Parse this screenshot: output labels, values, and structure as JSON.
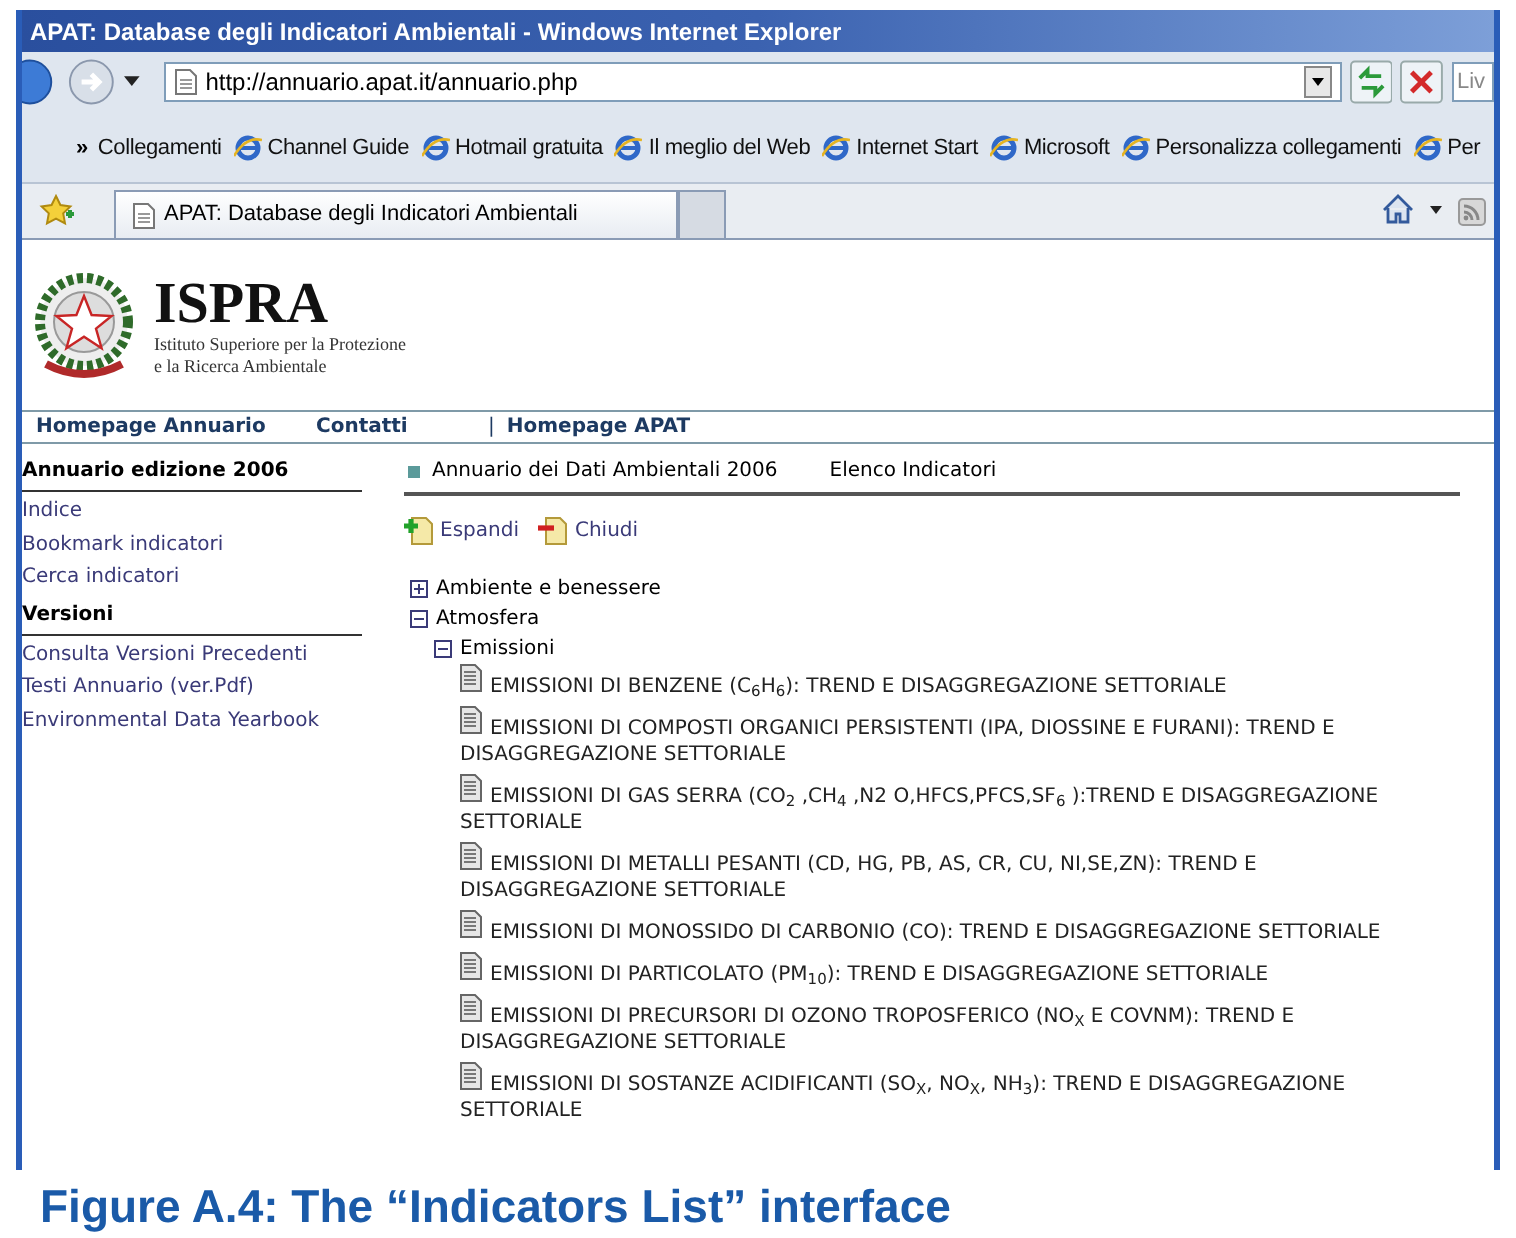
{
  "window": {
    "title": "APAT: Database degli Indicatori Ambientali - Windows Internet Explorer"
  },
  "address_bar": {
    "url": "http://annuario.apat.it/annuario.php",
    "search_placeholder": "Liv"
  },
  "links_bar": {
    "chevron": "»",
    "items": [
      "Collegamenti",
      "Channel Guide",
      "Hotmail gratuita",
      "Il meglio del Web",
      "Internet Start",
      "Microsoft",
      "Personalizza collegamenti",
      "Per"
    ]
  },
  "tabs": [
    {
      "label": "APAT: Database degli Indicatori Ambientali",
      "selected": true
    },
    {
      "selected": false
    }
  ],
  "header": {
    "logo_text": "ISPRA",
    "subtitle": [
      "Istituto Superiore per la Protezione",
      "e la Ricerca Ambientale"
    ]
  },
  "nav": [
    {
      "label": "Homepage Annuario"
    },
    {
      "label": "Contatti"
    },
    {
      "label": "Homepage APAT",
      "separator": "|"
    }
  ],
  "sidebar": [
    {
      "title": "Annuario edizione 2006",
      "items": [
        "Indice",
        "Bookmark indicatori",
        "Cerca indicatori"
      ]
    },
    {
      "title": "Versioni",
      "items": [
        "Consulta Versioni Precedenti",
        "Testi Annuario (ver.Pdf)",
        "Environmental Data Yearbook"
      ]
    }
  ],
  "breadcrumb": [
    "Annuario dei Dati Ambientali 2006",
    "Elenco Indicatori"
  ],
  "actions": [
    {
      "kind": "expand",
      "label": "Espandi"
    },
    {
      "kind": "collapse",
      "label": "Chiudi"
    }
  ],
  "tree": [
    {
      "kind": "folder",
      "label": "Ambiente e benessere",
      "expanded": false
    },
    {
      "kind": "folder",
      "label": "Atmosfera",
      "expanded": true,
      "children": [
        {
          "kind": "folder",
          "label": "Emissioni",
          "expanded": true,
          "children": [
            {
              "kind": "document",
              "label": "EMISSIONI DI BENZENE (C$_{6}$H$_{6}$): TREND E DISAGGREGAZIONE SETTORIALE"
            },
            {
              "kind": "document",
              "label": "EMISSIONI DI COMPOSTI ORGANICI PERSISTENTI (IPA, DIOSSINE E FURANI): TREND E DISAGGREGAZIONE SETTORIALE"
            },
            {
              "kind": "document",
              "label": "EMISSIONI DI GAS SERRA (CO$_{2}$ ,CH$_{4}$ ,N2 O,HFCS,PFCS,SF$_{6}$ ):TREND E DISAGGREGAZIONE SETTORIALE"
            },
            {
              "kind": "document",
              "label": "EMISSIONI DI METALLI PESANTI (CD, HG, PB, AS, CR, CU, NI,SE,ZN): TREND E DISAGGREGAZIONE SETTORIALE"
            },
            {
              "kind": "document",
              "label": "EMISSIONI DI MONOSSIDO DI CARBONIO (CO): TREND E DISAGGREGAZIONE SETTORIALE"
            },
            {
              "kind": "document",
              "label": "EMISSIONI DI PARTICOLATO (PM$_{10}$): TREND E DISAGGREGAZIONE SETTORIALE"
            },
            {
              "kind": "document",
              "label": "EMISSIONI DI PRECURSORI DI OZONO TROPOSFERICO (NO$_{X}$ E COVNM): TREND E DISAGGREGAZIONE SETTORIALE"
            },
            {
              "kind": "document",
              "label": "EMISSIONI DI SOSTANZE ACIDIFICANTI (SO$_{X}$, NO$_{X}$, NH$_{3}$): TREND E DISAGGREGAZIONE SETTORIALE"
            }
          ]
        }
      ]
    }
  ],
  "caption": "Figure A.4: The “Indicators List” interface"
}
